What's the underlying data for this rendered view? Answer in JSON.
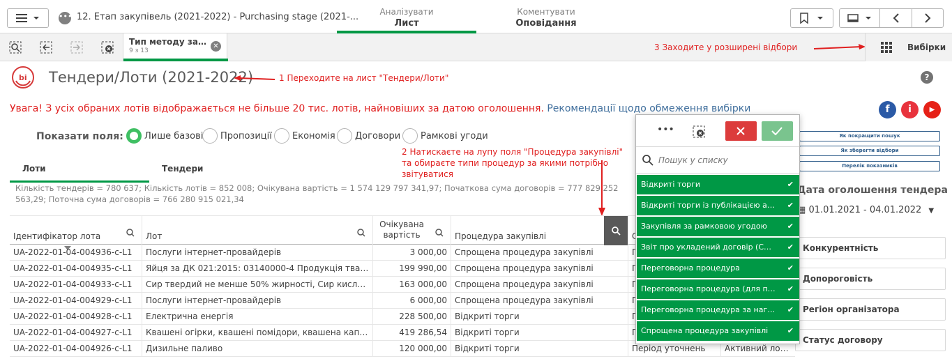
{
  "topbar": {
    "app_title": "12. Етап закупівель (2021-2022) - Purchasing stage (2021-...",
    "tabs": [
      {
        "sub": "Аналізувати",
        "main": "Лист"
      },
      {
        "sub": "Коментувати",
        "main": "Оповідання"
      }
    ]
  },
  "selection": {
    "pill_title": "Тип методу зак...",
    "pill_count": "9 з 13",
    "selections_label": "Вибірки"
  },
  "notes": {
    "n1": "1 Переходите на лист \"Тендери/Лоти\"",
    "n2_line1": "2 Натискаєте на лупу поля \"Процедура закупівлі\"",
    "n2_line2": "та обираєте типи процедур за якими потрібно",
    "n2_line3": "звітуватися",
    "n3": "3 Заходите у розширені відбори"
  },
  "sheet": {
    "logo": "bi",
    "title": "Тендери/Лоти (2021-2022)",
    "warning": "Увага! З усіх обраних лотів відображається не більше 20 тис. лотів, найновіших за датою оголошення.",
    "warning_link": "Рекомендації щодо обмеження вибірки"
  },
  "fields": {
    "label": "Показати поля:",
    "options": [
      "Лише базові",
      "Пропозиції",
      "Економія",
      "Договори",
      "Рамкові угоди"
    ]
  },
  "subtabs": [
    "Лоти",
    "Тендери"
  ],
  "stats": "Кількість тендерів = 780 637; Кількість лотів = 852 008; Очікувана вартість = 1 574 129 797 341,97; Початкова сума договорів = 777 829 252 563,29; Поточна сума договорів = 766 280 915 021,34",
  "table": {
    "headers": [
      "Ідентифікатор лота",
      "Лот",
      "Очікувана вартість",
      "Процедура закупівлі",
      "С"
    ],
    "rows": [
      {
        "id": "UA-2022-01-04-004936-c-L1",
        "lot": "Послуги інтернет-провайдерів",
        "value": "3 000,00",
        "proc": "Спрощена процедура закупівлі",
        "col5": "П",
        "col6": ""
      },
      {
        "id": "UA-2022-01-04-004935-c-L1",
        "lot": "Яйця за ДК 021:2015: 03140000-4 Продукція твар...",
        "value": "199 990,00",
        "proc": "Спрощена процедура закупівлі",
        "col5": "П",
        "col6": ""
      },
      {
        "id": "UA-2022-01-04-004933-c-L1",
        "lot": "Сир твердий не менше 50% жирності, Сир кисло-мо...",
        "value": "163 000,00",
        "proc": "Спрощена процедура закупівлі",
        "col5": "П",
        "col6": ""
      },
      {
        "id": "UA-2022-01-04-004929-c-L1",
        "lot": "Послуги інтернет-провайдерів",
        "value": "6 000,00",
        "proc": "Спрощена процедура закупівлі",
        "col5": "П",
        "col6": ""
      },
      {
        "id": "UA-2022-01-04-004928-c-L1",
        "lot": "Електрична енергія",
        "value": "228 500,00",
        "proc": "Відкриті торги",
        "col5": "П",
        "col6": ""
      },
      {
        "id": "UA-2022-01-04-004927-c-L1",
        "lot": "Квашені огірки, квашені помідори, квашена капуст...",
        "value": "419 286,54",
        "proc": "Відкриті торги",
        "col5": "П",
        "col6": ""
      },
      {
        "id": "UA-2022-01-04-004926-c-L1",
        "lot": "Дизильне паливо",
        "value": "120 000,00",
        "proc": "Відкриті торги",
        "col5": "Період уточнень",
        "col6": "Активний лот за"
      }
    ]
  },
  "listbox": {
    "search_placeholder": "Пошук у списку",
    "items": [
      "Відкриті торги",
      "Відкриті торги із публікацією англ. ...",
      "Закупівля за рамковою угодою",
      "Звіт про укладений договір (COVID-...",
      "Переговорна процедура",
      "Переговорна процедура (для потре...",
      "Переговорна процедура за нагальн...",
      "Спрощена процедура закупівлі"
    ]
  },
  "right_panel": {
    "buttons": [
      "Як покращити пошук",
      "Як зберегти відбори",
      "Перелік показників"
    ],
    "filter_title": "Дата оголошення тендера",
    "date_range": "01.01.2021 - 04.01.2022",
    "filters": [
      "Конкурентність",
      "Допороговість",
      "Регіон організатора",
      "Статус договору"
    ]
  },
  "colors": {
    "selected_green": "#009845",
    "annotation_red": "#e02020",
    "link_blue": "#3f6e9c"
  }
}
